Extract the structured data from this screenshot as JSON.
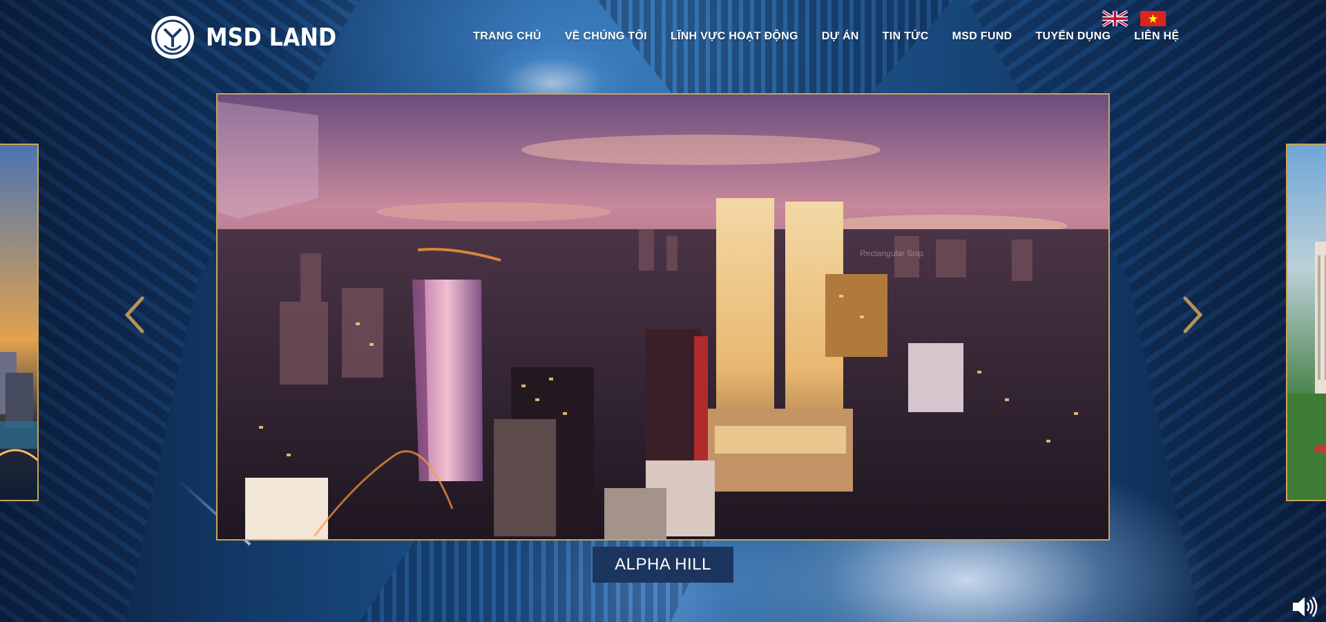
{
  "brand": {
    "name": "MSD LAND"
  },
  "nav": {
    "items": [
      {
        "label": "TRANG CHỦ"
      },
      {
        "label": "VỀ CHÚNG TÔI"
      },
      {
        "label": "LĨNH VỰC HOẠT ĐỘNG"
      },
      {
        "label": "DỰ ÁN"
      },
      {
        "label": "TIN TỨC"
      },
      {
        "label": "MSD FUND"
      },
      {
        "label": "TUYỂN DỤNG"
      },
      {
        "label": "LIÊN HỆ"
      }
    ]
  },
  "languages": [
    {
      "icon": "uk-flag-icon"
    },
    {
      "icon": "vietnam-flag-icon"
    }
  ],
  "slider": {
    "current_caption": "ALPHA HILL",
    "overlay_text": "Rectangular Snip",
    "prev_icon": "chevron-left-icon",
    "next_icon": "chevron-right-icon"
  },
  "audio": {
    "icon": "speaker-icon"
  },
  "colors": {
    "accent_gold": "#c9a55a",
    "caption_bg": "#1b355e",
    "nav_text": "#ffffff"
  }
}
